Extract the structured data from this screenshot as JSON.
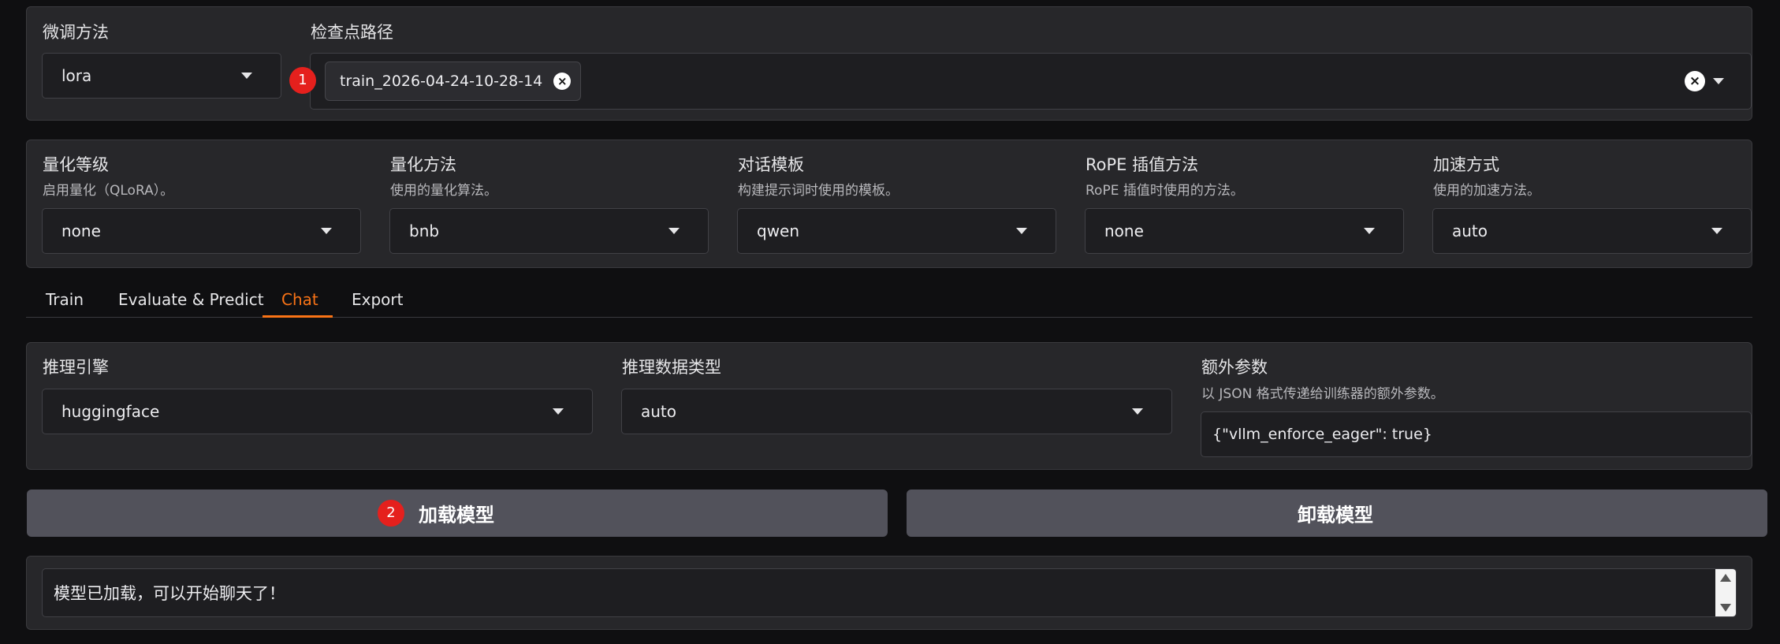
{
  "finetune": {
    "method_label": "微调方法",
    "method_value": "lora",
    "checkpoint_label": "检查点路径",
    "checkpoint_chip": "train_2026-04-24-10-28-14",
    "badge": "1"
  },
  "settings": [
    {
      "label": "量化等级",
      "desc": "启用量化（QLoRA）。",
      "value": "none"
    },
    {
      "label": "量化方法",
      "desc": "使用的量化算法。",
      "value": "bnb"
    },
    {
      "label": "对话模板",
      "desc": "构建提示词时使用的模板。",
      "value": "qwen"
    },
    {
      "label": "RoPE 插值方法",
      "desc": "RoPE 插值时使用的方法。",
      "value": "none"
    },
    {
      "label": "加速方式",
      "desc": "使用的加速方法。",
      "value": "auto"
    }
  ],
  "tabs": [
    {
      "label": "Train"
    },
    {
      "label": "Evaluate & Predict"
    },
    {
      "label": "Chat"
    },
    {
      "label": "Export"
    }
  ],
  "active_tab": "Chat",
  "infer": {
    "engine_label": "推理引擎",
    "engine_value": "huggingface",
    "dtype_label": "推理数据类型",
    "dtype_value": "auto",
    "extra_label": "额外参数",
    "extra_desc": "以 JSON 格式传递给训练器的额外参数。",
    "extra_value": "{\"vllm_enforce_eager\": true}"
  },
  "actions": {
    "load_label": "加载模型",
    "load_badge": "2",
    "unload_label": "卸载模型"
  },
  "status": {
    "message": "模型已加载，可以开始聊天了！"
  },
  "colors": {
    "accent": "#f97316",
    "badge": "#e5201d",
    "panel": "#27272a",
    "button": "#52525b"
  }
}
